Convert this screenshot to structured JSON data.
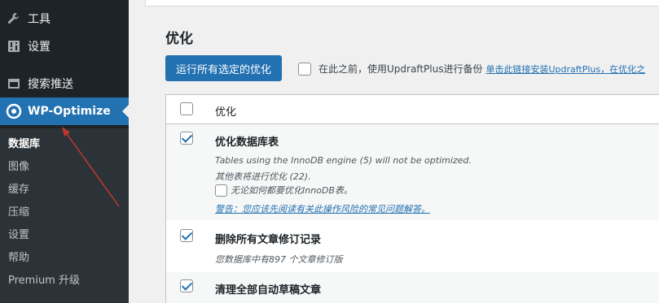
{
  "sidebar": {
    "items": [
      {
        "label": "工具",
        "icon": "wrench-icon"
      },
      {
        "label": "设置",
        "icon": "settings-sliders-icon"
      },
      {
        "label": "搜索推送",
        "icon": "push-icon"
      },
      {
        "label": "WP-Optimize",
        "icon": "wp-optimize-icon"
      }
    ],
    "submenu": [
      {
        "label": "数据库"
      },
      {
        "label": "图像"
      },
      {
        "label": "缓存"
      },
      {
        "label": "压缩"
      },
      {
        "label": "设置"
      },
      {
        "label": "帮助"
      },
      {
        "label": "Premium 升级"
      }
    ]
  },
  "main": {
    "section_title": "优化",
    "run_button": "运行所有选定的优化",
    "backup_label": "在此之前，使用UpdraftPlus进行备份",
    "backup_link": "单击此链接安装UpdraftPlus，在优化之",
    "table": {
      "header_label": "优化",
      "rows": [
        {
          "title": "优化数据库表",
          "note1": "Tables using the InnoDB engine (5) will not be optimized.",
          "note2": "其他表将进行优化 (22).",
          "force_label": "无论如何都要优化InnoDB表。",
          "warning_link": "警告：您应该先阅读有关此操作风险的常见问题解答。"
        },
        {
          "title": "删除所有文章修订记录",
          "note1": "您数据库中有897 个文章修订版"
        },
        {
          "title": "清理全部自动草稿文章"
        }
      ]
    }
  },
  "colors": {
    "sidebar_bg": "#1d2327",
    "submenu_bg": "#2c3338",
    "accent": "#2271b1",
    "annotation_arrow": "#c0392b"
  }
}
